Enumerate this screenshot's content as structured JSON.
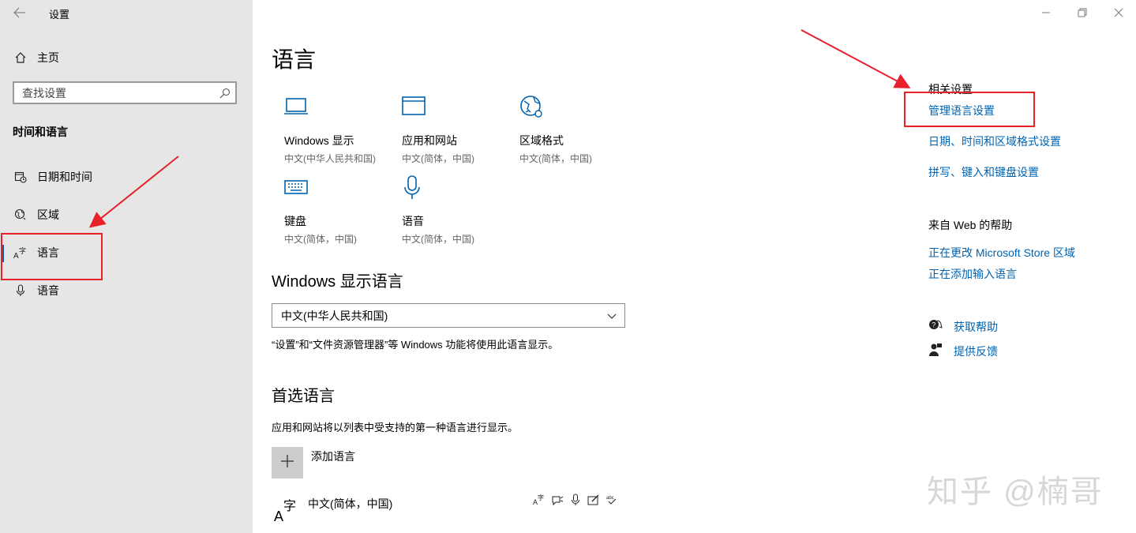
{
  "window": {
    "title": "设置",
    "controls": [
      "minimize",
      "restore",
      "close"
    ]
  },
  "sidebar": {
    "home_label": "主页",
    "search_placeholder": "查找设置",
    "section_title": "时间和语言",
    "items": [
      {
        "label": "日期和时间",
        "icon": "clock-calendar-icon"
      },
      {
        "label": "区域",
        "icon": "globe-icon"
      },
      {
        "label": "语言",
        "icon": "language-icon",
        "active": true
      },
      {
        "label": "语音",
        "icon": "microphone-icon"
      }
    ]
  },
  "main": {
    "title": "语言",
    "tiles": [
      {
        "title": "Windows 显示",
        "subtitle": "中文(中华人民共和国)",
        "icon": "monitor-icon"
      },
      {
        "title": "应用和网站",
        "subtitle": "中文(简体，中国)",
        "icon": "browser-window-icon"
      },
      {
        "title": "区域格式",
        "subtitle": "中文(简体，中国)",
        "icon": "globe-settings-icon"
      },
      {
        "title": "键盘",
        "subtitle": "中文(简体，中国)",
        "icon": "keyboard-icon"
      },
      {
        "title": "语音",
        "subtitle": "中文(简体，中国)",
        "icon": "microphone-icon"
      }
    ],
    "display_language": {
      "heading": "Windows 显示语言",
      "selected": "中文(中华人民共和国)",
      "description": "“设置”和“文件资源管理器”等 Windows 功能将使用此语言显示。"
    },
    "preferred": {
      "heading": "首选语言",
      "description": "应用和网站将以列表中受支持的第一种语言进行显示。",
      "add_label": "添加语言",
      "languages": [
        {
          "name": "中文(简体，中国)",
          "features": [
            "display-language-icon",
            "text-to-speech-icon",
            "speech-recognition-icon",
            "handwriting-icon",
            "spell-check-icon"
          ]
        }
      ]
    }
  },
  "right": {
    "related_heading": "相关设置",
    "related_links": [
      "管理语言设置",
      "日期、时间和区域格式设置",
      "拼写、键入和键盘设置"
    ],
    "web_help_heading": "来自 Web 的帮助",
    "web_help_links": [
      "正在更改 Microsoft Store 区域",
      "正在添加输入语言"
    ],
    "get_help": "获取帮助",
    "feedback": "提供反馈"
  },
  "watermark": "知乎 @楠哥",
  "colors": {
    "accent": "#0063b1",
    "sidebar_bg": "#e6e6e6",
    "annotation": "#e8202a"
  }
}
